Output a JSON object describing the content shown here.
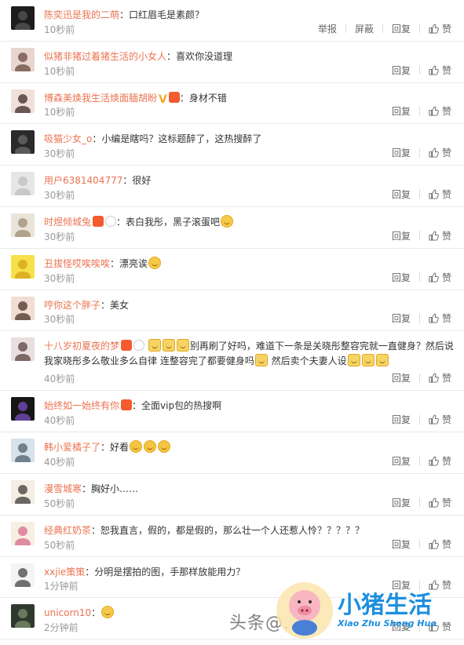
{
  "actions": {
    "reply": "回复",
    "like": "赞",
    "report": "举报",
    "block": "屏蔽"
  },
  "comments": [
    {
      "username": "陈奕迅是我的二萌",
      "text": "口红眉毛是素颜？",
      "time": "10秒前",
      "badges": [],
      "emojis": [],
      "has_report": true,
      "avatar": "dark"
    },
    {
      "username": "似猪非猪过着猪生活的小女人",
      "text": "喜欢你没道理",
      "time": "10秒前",
      "badges": [],
      "emojis": [],
      "has_report": false,
      "avatar": "girl"
    },
    {
      "username": "博森美焕我生活焕面腼胡盼",
      "text": "身材不错",
      "time": "10秒前",
      "badges": [
        "v",
        "vip"
      ],
      "emojis": [],
      "has_report": false,
      "avatar": "girl2"
    },
    {
      "username": "吸猫少女_o",
      "text": "小编是瞎吗？这标题醉了，这热搜醉了",
      "time": "30秒前",
      "badges": [],
      "emojis": [],
      "has_report": false,
      "avatar": "dark2"
    },
    {
      "username": "用户6381404777",
      "text": "很好",
      "time": "30秒前",
      "badges": [],
      "emojis": [],
      "has_report": false,
      "avatar": "default"
    },
    {
      "username": "时煜倾城兔",
      "text": "表白我彤，黑子滚蛋吧",
      "time": "30秒前",
      "badges": [
        "vip",
        "panda"
      ],
      "emojis": [
        "smile"
      ],
      "has_report": false,
      "avatar": "animal"
    },
    {
      "username": "丑拔怪哎唉唉唉",
      "text": "漂亮诶",
      "time": "30秒前",
      "badges": [],
      "emojis": [
        "smile"
      ],
      "has_report": false,
      "avatar": "sponge"
    },
    {
      "username": "哼你这个胖子",
      "text": "美女",
      "time": "30秒前",
      "badges": [],
      "emojis": [],
      "has_report": false,
      "avatar": "girl3"
    },
    {
      "username": "十八岁初夏夜的梦",
      "text_pre": "",
      "text": "别再刷了好吗，难道下一条是关晓彤整容完就一直健身？然后说我家晓彤多么敬业多么自律 连整容完了都要健身吗",
      "text_post": "然后卖个夫妻人设",
      "time": "40秒前",
      "badges": [
        "vip",
        "panda"
      ],
      "emojis": [
        "cat",
        "cat",
        "cat"
      ],
      "emojis_mid": [
        "cat"
      ],
      "emojis_end": [
        "cat",
        "cat",
        "cat"
      ],
      "has_report": false,
      "avatar": "girl4",
      "tall": true
    },
    {
      "username": "始终如一始终有你",
      "text": "全面vip包的热搜啊",
      "time": "40秒前",
      "badges": [
        "vip"
      ],
      "emojis": [],
      "has_report": false,
      "avatar": "dark3"
    },
    {
      "username": "韩小爱橘子了",
      "text": "好看",
      "time": "40秒前",
      "badges": [],
      "emojis": [
        "laugh",
        "laugh",
        "laugh"
      ],
      "has_report": false,
      "avatar": "girl5"
    },
    {
      "username": "漫雪城寒",
      "text": "胸好小……",
      "time": "50秒前",
      "badges": [],
      "emojis": [],
      "has_report": false,
      "avatar": "cartoon"
    },
    {
      "username": "经典红奶茶",
      "text": "恕我直言，假的，都是假的，那么壮一个人还惹人怜？？？？？",
      "time": "50秒前",
      "badges": [],
      "emojis": [],
      "has_report": false,
      "avatar": "flower"
    },
    {
      "username": "xxjie策策",
      "text": "分明是摆拍的图，手那样放能用力？",
      "time": "1分钟前",
      "badges": [],
      "emojis": [],
      "has_report": false,
      "avatar": "bunny"
    },
    {
      "username": "unicorn10",
      "text": "",
      "time": "2分钟前",
      "badges": [],
      "emojis": [
        "smile"
      ],
      "has_report": false,
      "avatar": "dark4"
    }
  ],
  "watermark": {
    "text": "头条@...",
    "title": "小猪生活",
    "subtitle": "Xiao Zhu Sheng Huo"
  },
  "colors": {
    "username": "#eb7350",
    "time": "#999999",
    "watermark_blue": "#1e8fe0"
  }
}
